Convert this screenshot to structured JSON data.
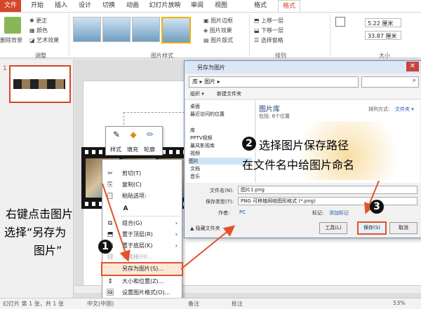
{
  "tabs": [
    "文件",
    "开始",
    "插入",
    "设计",
    "切换",
    "动画",
    "幻灯片放映",
    "审阅",
    "视图",
    "格式",
    "格式"
  ],
  "ribbon": {
    "remove_bg": "删除背景",
    "adjust": {
      "corrections": "更正",
      "color": "颜色",
      "artistic": "艺术效果",
      "label": "调整"
    },
    "picture_styles": {
      "border": "图片边框",
      "effects": "图片效果",
      "layout": "图片版式",
      "label": "图片样式"
    },
    "arrange": {
      "bring_forward": "上移一层",
      "send_backward": "下移一层",
      "selection_pane": "选择窗格",
      "label": "排列"
    },
    "size": {
      "height": "5.22 厘米",
      "width": "33.87 厘米",
      "label": "大小"
    }
  },
  "slide_number": "1",
  "mini_toolbar": {
    "style": "样式",
    "fill": "填充",
    "outline": "轮廓"
  },
  "context_menu": [
    {
      "icon": "✂",
      "label": "剪切(T)",
      "arrow": ""
    },
    {
      "icon": "⎘",
      "label": "复制(C)",
      "arrow": ""
    },
    {
      "icon": "📋",
      "label": "粘贴选项:",
      "arrow": ""
    },
    {
      "icon": "A",
      "label": "",
      "arrow": ""
    },
    {
      "icon": "⧉",
      "label": "组合(G)",
      "arrow": "›"
    },
    {
      "icon": "⬒",
      "label": "置于顶层(R)",
      "arrow": "›"
    },
    {
      "icon": "⬓",
      "label": "置于底层(K)",
      "arrow": "›"
    },
    {
      "icon": "⛓",
      "label": "超链接(H)...",
      "arrow": ""
    },
    {
      "icon": "",
      "label": "另存为图片(S)...",
      "arrow": ""
    },
    {
      "icon": "⇕",
      "label": "大小和位置(Z)...",
      "arrow": ""
    },
    {
      "icon": "🖼",
      "label": "设置图片格式(O)...",
      "arrow": ""
    }
  ],
  "dialog": {
    "title": "另存为图片",
    "path": "库 ▸ 图片 ▸",
    "organize": "组织 ▾",
    "new_folder": "新建文件夹",
    "nav": [
      "桌面",
      "最近访问的位置",
      "库",
      "PPTV视频",
      "暴风影视库",
      "视频",
      "图片",
      "文档",
      "音乐"
    ],
    "library_title": "图片库",
    "library_sub": "包括: 6个位置",
    "arrange_label": "排列方式:",
    "arrange_value": "文件夹 ▾",
    "filename_label": "文件名(N):",
    "filename_value": "图片1.png",
    "type_label": "保存类型(T):",
    "type_value": "PNG 可移植网络图形格式 (*.png)",
    "author_label": "作者:",
    "author_value": "PC",
    "tags_label": "标记:",
    "tags_value": "添加标记",
    "hide_folders": "隐藏文件夹",
    "tools": "工具(L)",
    "save": "保存(S)",
    "cancel": "取消"
  },
  "status": {
    "slide": "幻灯片 第 1 张，共 1 张",
    "lang": "中文(中国)",
    "notes": "备注",
    "comments": "批注",
    "zoom": "53%"
  },
  "annotations": {
    "step1": "1",
    "step2": "2",
    "step3": "3",
    "text2_line1": "选择图片保存路径",
    "text2_line2": "在文件名中给图片命名",
    "text1_line1": "右键点击图片",
    "text1_line2": "选择“另存为",
    "text1_line3": "图片”"
  },
  "colors": {
    "accent": "#d24726",
    "highlight": "#e2522b"
  }
}
